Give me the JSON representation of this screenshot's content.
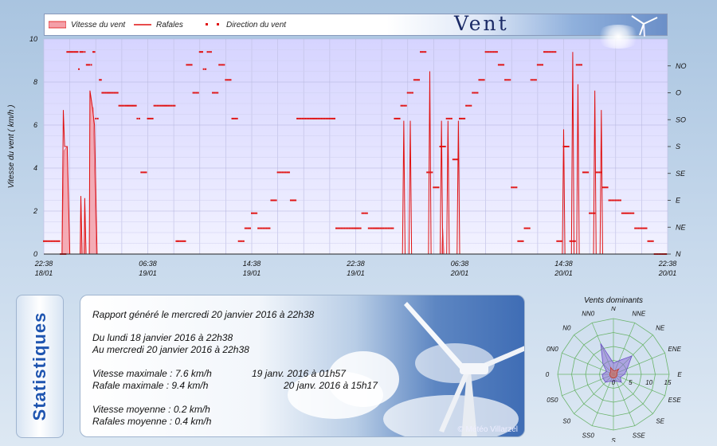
{
  "header": {
    "title": "Vent",
    "legend": [
      {
        "label": "Vitesse du vent",
        "kind": "area"
      },
      {
        "label": "Rafales",
        "kind": "line"
      },
      {
        "label": "Direction du vent",
        "kind": "dots"
      }
    ]
  },
  "colors": {
    "area": "#f4a0a8",
    "line": "#e01010",
    "dots": "#e01010",
    "plot_bg": "#dad9ff",
    "grid": "#b0b0d8"
  },
  "chart_data": [
    {
      "type": "area",
      "title": "",
      "ylabel": "Vitesse du vent ( km/h )",
      "ylim": [
        0,
        10
      ],
      "yticks": [
        "0",
        "2",
        "4",
        "6",
        "8",
        "10"
      ],
      "xticks": [
        {
          "hour": 0,
          "label1": "22:38",
          "label2": "18/01"
        },
        {
          "hour": 8,
          "label1": "06:38",
          "label2": "19/01"
        },
        {
          "hour": 16,
          "label1": "14:38",
          "label2": "19/01"
        },
        {
          "hour": 24,
          "label1": "22:38",
          "label2": "19/01"
        },
        {
          "hour": 32,
          "label1": "06:38",
          "label2": "20/01"
        },
        {
          "hour": 40,
          "label1": "14:38",
          "label2": "20/01"
        },
        {
          "hour": 48,
          "label1": "22:38",
          "label2": "20/01"
        }
      ],
      "direction_axis": [
        "N",
        "NE",
        "E",
        "SE",
        "S",
        "SO",
        "O",
        "NO"
      ],
      "series": [
        {
          "name": "Vitesse du vent",
          "points": [
            [
              0,
              0
            ],
            [
              1.4,
              0
            ],
            [
              1.55,
              4.8
            ],
            [
              1.8,
              5
            ],
            [
              2.0,
              0
            ],
            [
              2.8,
              0
            ],
            [
              2.85,
              2.7
            ],
            [
              2.95,
              0
            ],
            [
              3.1,
              0
            ],
            [
              3.15,
              2.6
            ],
            [
              3.25,
              0
            ],
            [
              3.5,
              0
            ],
            [
              3.55,
              7.6
            ],
            [
              3.7,
              6.9
            ],
            [
              3.8,
              6.8
            ],
            [
              3.9,
              4
            ],
            [
              4.05,
              0
            ],
            [
              30.6,
              0
            ],
            [
              30.7,
              1.2
            ],
            [
              30.8,
              0
            ],
            [
              48,
              0
            ]
          ]
        },
        {
          "name": "Rafales",
          "points": [
            [
              0,
              0
            ],
            [
              1.4,
              0
            ],
            [
              1.5,
              6.7
            ],
            [
              1.6,
              5
            ],
            [
              1.8,
              5
            ],
            [
              2.0,
              0
            ],
            [
              2.8,
              0
            ],
            [
              2.85,
              2.7
            ],
            [
              2.95,
              0
            ],
            [
              3.1,
              0
            ],
            [
              3.15,
              2.6
            ],
            [
              3.25,
              0
            ],
            [
              3.5,
              0
            ],
            [
              3.55,
              7.6
            ],
            [
              3.7,
              7
            ],
            [
              3.9,
              6
            ],
            [
              4.1,
              0
            ],
            [
              27.6,
              0
            ],
            [
              27.7,
              6.2
            ],
            [
              27.8,
              0
            ],
            [
              28.1,
              0
            ],
            [
              28.2,
              6.2
            ],
            [
              28.3,
              0
            ],
            [
              29.6,
              0
            ],
            [
              29.7,
              8.5
            ],
            [
              29.8,
              0
            ],
            [
              30.5,
              0
            ],
            [
              30.6,
              6.2
            ],
            [
              30.7,
              0
            ],
            [
              31.0,
              0
            ],
            [
              31.1,
              6.2
            ],
            [
              31.2,
              0
            ],
            [
              31.8,
              0
            ],
            [
              31.9,
              6.2
            ],
            [
              32.0,
              0
            ],
            [
              39.9,
              0
            ],
            [
              40.0,
              5.8
            ],
            [
              40.1,
              0
            ],
            [
              40.6,
              0
            ],
            [
              40.7,
              9.4
            ],
            [
              40.8,
              0
            ],
            [
              41.0,
              0
            ],
            [
              41.1,
              7.9
            ],
            [
              41.2,
              0
            ],
            [
              42.3,
              0
            ],
            [
              42.4,
              7.6
            ],
            [
              42.5,
              0
            ],
            [
              42.8,
              0
            ],
            [
              42.9,
              6.7
            ],
            [
              43.0,
              0
            ],
            [
              48,
              0
            ]
          ]
        },
        {
          "name": "Direction du vent",
          "points": [
            [
              0,
              0.6
            ],
            [
              1.2,
              0.6
            ],
            [
              1.3,
              0
            ],
            [
              1.8,
              9.4
            ],
            [
              2.6,
              9.4
            ],
            [
              2.7,
              8.6
            ],
            [
              2.8,
              9.4
            ],
            [
              3.0,
              9.4
            ],
            [
              3.3,
              8.8
            ],
            [
              3.5,
              8.8
            ],
            [
              3.8,
              9.4
            ],
            [
              4.0,
              6.3
            ],
            [
              4.3,
              8.1
            ],
            [
              4.5,
              7.5
            ],
            [
              5.2,
              7.5
            ],
            [
              5.8,
              6.9
            ],
            [
              6.3,
              6.9
            ],
            [
              7.2,
              6.3
            ],
            [
              7.5,
              3.8
            ],
            [
              8.0,
              6.3
            ],
            [
              8.5,
              6.9
            ],
            [
              9.0,
              6.9
            ],
            [
              9.7,
              6.9
            ],
            [
              10.2,
              0.6
            ],
            [
              10.4,
              0.6
            ],
            [
              11.0,
              8.8
            ],
            [
              11.5,
              7.5
            ],
            [
              12.0,
              9.4
            ],
            [
              12.3,
              8.6
            ],
            [
              12.6,
              9.4
            ],
            [
              13.0,
              7.5
            ],
            [
              13.5,
              8.8
            ],
            [
              14.0,
              8.1
            ],
            [
              14.5,
              6.3
            ],
            [
              15.0,
              0.6
            ],
            [
              15.5,
              1.2
            ],
            [
              16.0,
              1.9
            ],
            [
              16.5,
              1.2
            ],
            [
              17.0,
              1.2
            ],
            [
              17.5,
              2.5
            ],
            [
              18.0,
              3.8
            ],
            [
              18.5,
              3.8
            ],
            [
              19.0,
              2.5
            ],
            [
              19.5,
              6.3
            ],
            [
              20.0,
              6.3
            ],
            [
              21.0,
              6.3
            ],
            [
              22.0,
              6.3
            ],
            [
              22.5,
              1.2
            ],
            [
              23.0,
              1.2
            ],
            [
              24.0,
              1.2
            ],
            [
              24.5,
              1.9
            ],
            [
              25.0,
              1.2
            ],
            [
              26.0,
              1.2
            ],
            [
              27.0,
              6.3
            ],
            [
              27.5,
              6.9
            ],
            [
              28.0,
              7.5
            ],
            [
              28.5,
              8.1
            ],
            [
              29.0,
              9.4
            ],
            [
              29.5,
              3.8
            ],
            [
              30.0,
              3.1
            ],
            [
              30.5,
              5.0
            ],
            [
              31.0,
              6.3
            ],
            [
              31.5,
              4.4
            ],
            [
              32.0,
              6.3
            ],
            [
              32.5,
              6.9
            ],
            [
              33.0,
              7.5
            ],
            [
              33.5,
              8.1
            ],
            [
              34.0,
              9.4
            ],
            [
              34.5,
              9.4
            ],
            [
              35.0,
              8.8
            ],
            [
              35.5,
              8.1
            ],
            [
              36.0,
              3.1
            ],
            [
              36.5,
              0.6
            ],
            [
              37.0,
              1.2
            ],
            [
              37.5,
              8.1
            ],
            [
              38.0,
              8.8
            ],
            [
              38.5,
              9.4
            ],
            [
              39.0,
              9.4
            ],
            [
              39.5,
              0.6
            ],
            [
              40.0,
              5.0
            ],
            [
              40.5,
              0.6
            ],
            [
              41.0,
              8.8
            ],
            [
              41.5,
              3.8
            ],
            [
              42.0,
              1.9
            ],
            [
              42.5,
              3.8
            ],
            [
              43.0,
              3.1
            ],
            [
              43.5,
              2.5
            ],
            [
              44.0,
              2.5
            ],
            [
              44.5,
              1.9
            ],
            [
              45.0,
              1.9
            ],
            [
              45.5,
              1.2
            ],
            [
              46.0,
              1.2
            ],
            [
              46.5,
              0.6
            ],
            [
              47.0,
              0
            ],
            [
              47.5,
              0
            ],
            [
              48,
              0
            ]
          ]
        }
      ]
    },
    {
      "type": "radar",
      "title": "Vents dominants",
      "directions": [
        "N",
        "NNE",
        "NE",
        "ENE",
        "E",
        "ESE",
        "SE",
        "SSE",
        "S",
        "SSO",
        "SO",
        "OSO",
        "O",
        "ONO",
        "NO",
        "NNO"
      ],
      "direction_labels": [
        "N",
        "NNE",
        "NE",
        "ENE",
        "E",
        "ESE",
        "SE",
        "SSE",
        "S",
        "SS0",
        "S0",
        "0S0",
        "0",
        "0N0",
        "N0",
        "NN0"
      ],
      "rmax": 15,
      "radial_ticks": [
        "0",
        "5",
        "10",
        "15"
      ],
      "series": [
        {
          "name": "",
          "values": [
            3,
            4,
            7,
            4,
            3,
            2,
            3,
            2,
            2,
            2,
            3,
            3,
            3,
            2,
            4,
            9
          ],
          "color": "#8a6fd6"
        },
        {
          "name": "",
          "values": [
            1,
            1,
            2,
            1,
            1,
            1,
            1,
            1,
            1,
            1,
            1,
            1,
            1,
            1,
            1,
            2
          ],
          "color": "#e06a5a"
        }
      ]
    }
  ],
  "stats": {
    "tab_label": "Statistiques",
    "generated": "Rapport généré le mercredi 20 janvier 2016 à 22h38",
    "from": "Du lundi 18 janvier 2016 à 22h38",
    "to": "Au mercredi 20 janvier 2016 à 22h38",
    "max_speed": "Vitesse maximale : 7.6 km/h",
    "max_speed_time": "19 janv. 2016 à 01h57",
    "max_gust": "Rafale maximale : 9.4 km/h",
    "max_gust_time": "20 janv. 2016 à 15h17",
    "avg_speed": "Vitesse moyenne : 0.2 km/h",
    "avg_gust": "Rafales moyenne : 0.4 km/h",
    "copyright": "© Météo Villarzel"
  }
}
